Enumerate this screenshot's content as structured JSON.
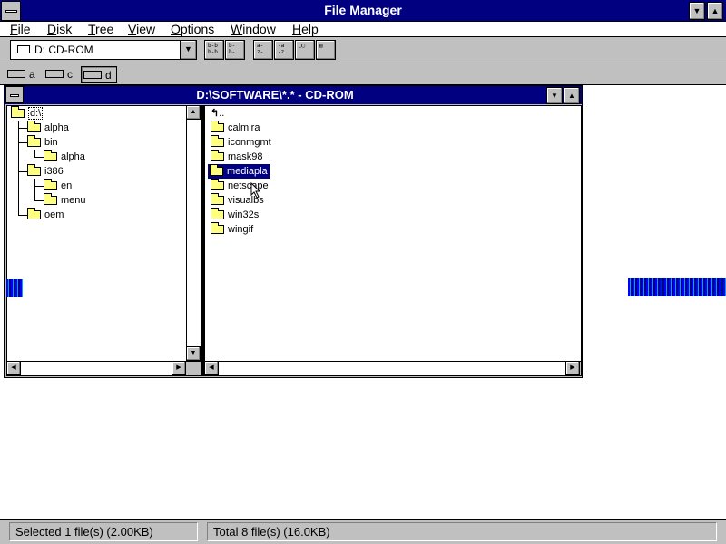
{
  "app": {
    "title": "File Manager"
  },
  "menu": [
    {
      "label": "File"
    },
    {
      "label": "Disk"
    },
    {
      "label": "Tree"
    },
    {
      "label": "View"
    },
    {
      "label": "Options"
    },
    {
      "label": "Window"
    },
    {
      "label": "Help"
    }
  ],
  "toolbar": {
    "drive_selector": "D: CD-ROM",
    "buttons": [
      "connect-network-drive-icon",
      "disconnect-network-drive-icon",
      "view-by-name-icon",
      "view-by-type-icon",
      "copy-disk-icon",
      "file-details-icon"
    ]
  },
  "drives": [
    {
      "letter": "a",
      "type": "floppy"
    },
    {
      "letter": "c",
      "type": "hard-disk"
    },
    {
      "letter": "d",
      "type": "cd-rom",
      "selected": true
    }
  ],
  "child_window": {
    "title": "D:\\SOFTWARE\\*.* - CD-ROM",
    "tree": [
      {
        "label": "d:\\",
        "level": 0,
        "open": true
      },
      {
        "label": "alpha",
        "level": 1
      },
      {
        "label": "bin",
        "level": 1
      },
      {
        "label": "alpha",
        "level": 2
      },
      {
        "label": "i386",
        "level": 1
      },
      {
        "label": "en",
        "level": 2
      },
      {
        "label": "menu",
        "level": 2
      },
      {
        "label": "oem",
        "level": 1
      }
    ],
    "files": [
      {
        "label": ".."
      },
      {
        "label": "calmira"
      },
      {
        "label": "iconmgmt"
      },
      {
        "label": "mask98"
      },
      {
        "label": "mediapla",
        "selected": true
      },
      {
        "label": "netscape"
      },
      {
        "label": "visualbs"
      },
      {
        "label": "win32s"
      },
      {
        "label": "wingif"
      }
    ]
  },
  "status": {
    "selected": "Selected 1 file(s) (2.00KB)",
    "total": "Total 8 file(s) (16.0KB)"
  },
  "colors": {
    "title_bar": "#000080",
    "face": "#c0c0c0",
    "selection": "#000080",
    "folder": "#ffff80"
  }
}
